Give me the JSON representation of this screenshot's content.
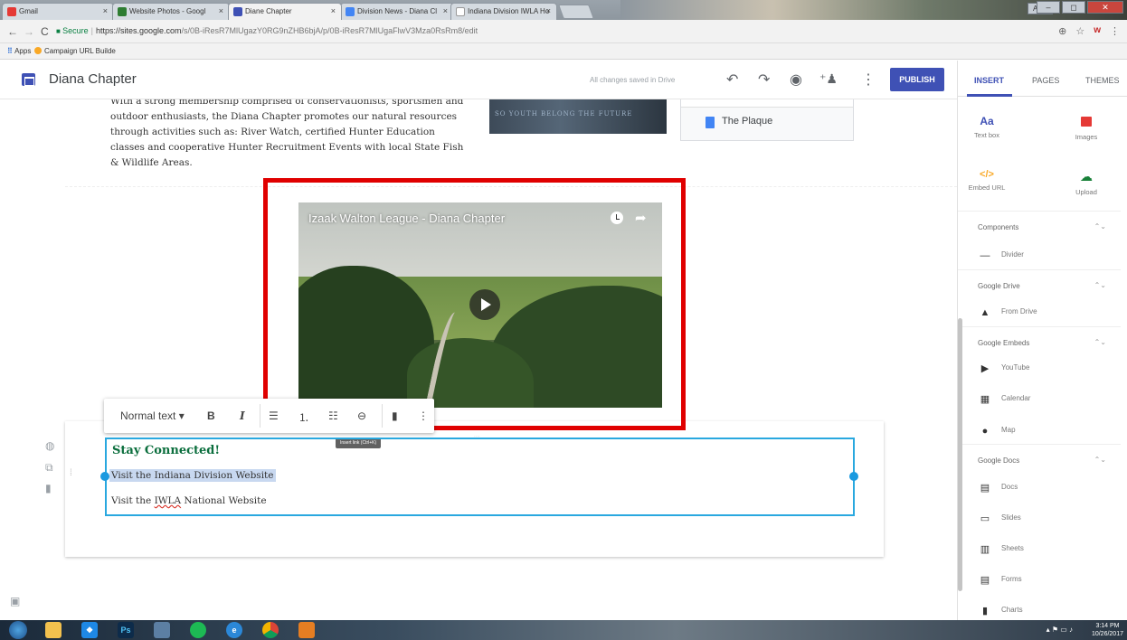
{
  "browser": {
    "tabs": [
      {
        "label": "Gmail",
        "close": "×"
      },
      {
        "label": "Website Photos - Googl",
        "close": "×"
      },
      {
        "label": "Diane Chapter",
        "close": "×"
      },
      {
        "label": "Division News - Diana Cl",
        "close": "×"
      },
      {
        "label": "Indiana Division IWLA Ho",
        "close": "×"
      }
    ],
    "user_chip": "Amy",
    "window_controls": {
      "minimize": "–",
      "maximize": "◻",
      "close": "✕"
    },
    "nav": {
      "back": "←",
      "forward": "→",
      "reload": "C"
    },
    "secure_label": "Secure",
    "url_host": "https://sites.google.com",
    "url_path": "/s/0B-iResR7MlUgazY0RG9nZHB6bjA/p/0B-iResR7MlUgaFlwV3Mza0RsRm8/edit",
    "bookmarks": [
      "Apps",
      "Campaign URL Builde"
    ]
  },
  "colors": {
    "accent": "#3f51b5",
    "highlight_box": "#e00000",
    "heading_green": "#0b6e3d",
    "selection_blue": "#29a8df"
  },
  "header": {
    "title": "Diana Chapter",
    "save_status": "All changes saved in Drive",
    "publish_label": "PUBLISH",
    "icons": [
      "undo-icon",
      "redo-icon",
      "preview-icon",
      "share-icon",
      "more-icon"
    ]
  },
  "content": {
    "paragraph": "With a strong membership comprised of conservationists, sportsmen and outdoor enthusiasts, the Diana Chapter promotes our natural resources through activities such as: River Watch, certified Hunter Education classes and cooperative Hunter Recruitment Events with local State Fish & Wildlife Areas.",
    "photo_caption": "SO YOUTH BELONG THE FUTURE",
    "drive_doc_name": "The Plaque",
    "video_title": "Izaak Walton League - Diana Chapter",
    "text_section": {
      "heading": "Stay Connected!",
      "link1": "Visit the Indiana Division Website",
      "link2_prefix": "Visit the ",
      "link2_abbr": "IWLA",
      "link2_suffix": " National Website"
    }
  },
  "toolbar": {
    "style_select": "Normal text",
    "bold": "B",
    "italic": "I",
    "tooltip": "Insert link (Ctrl+K)"
  },
  "panel": {
    "tabs": [
      "INSERT",
      "PAGES",
      "THEMES"
    ],
    "insert_items": [
      {
        "label": "Text box",
        "icon": "Aa"
      },
      {
        "label": "Images",
        "icon": "images-icon"
      },
      {
        "label": "Embed URL",
        "icon": "</>"
      },
      {
        "label": "Upload",
        "icon": "upload-icon"
      }
    ],
    "sections": [
      {
        "title": "Components",
        "items": [
          "Divider"
        ]
      },
      {
        "title": "Google Drive",
        "items": [
          "From Drive"
        ]
      },
      {
        "title": "Google Embeds",
        "items": [
          "YouTube",
          "Calendar",
          "Map"
        ]
      },
      {
        "title": "Google Docs",
        "items": [
          "Docs",
          "Slides",
          "Sheets",
          "Forms",
          "Charts"
        ]
      }
    ]
  },
  "taskbar": {
    "time": "3:14 PM",
    "date": "10/26/2017",
    "photoshop": "Ps"
  }
}
